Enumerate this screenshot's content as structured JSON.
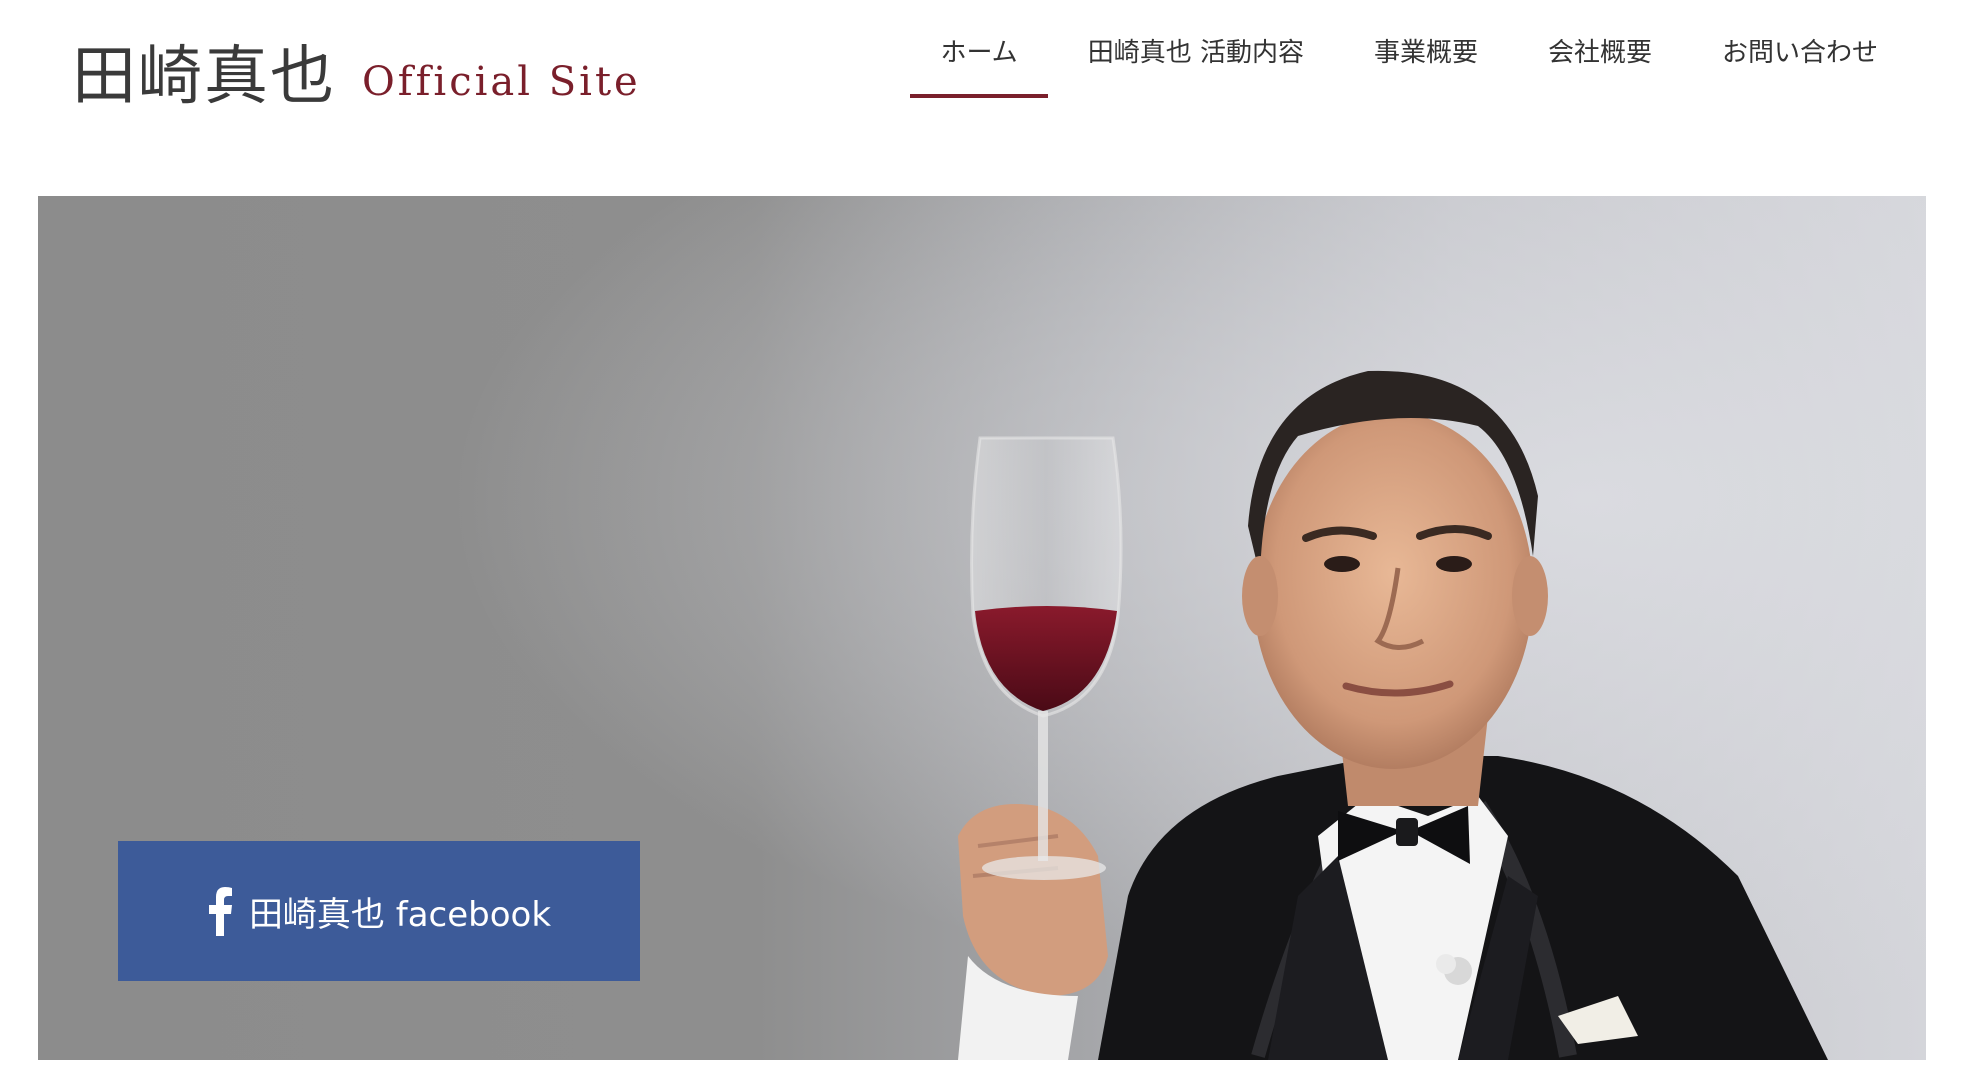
{
  "header": {
    "logo": {
      "name": "田崎真也",
      "subtitle": "Official Site"
    },
    "nav": {
      "items": [
        {
          "label": "ホーム",
          "active": true
        },
        {
          "label": "田崎真也 活動内容",
          "active": false
        },
        {
          "label": "事業概要",
          "active": false
        },
        {
          "label": "会社概要",
          "active": false
        },
        {
          "label": "お問い合わせ",
          "active": false
        }
      ]
    }
  },
  "hero": {
    "image": "portrait-sommelier-holding-red-wine-glass",
    "facebook_button": {
      "icon": "facebook-icon",
      "label": "田崎真也 facebook"
    }
  },
  "colors": {
    "accent": "#7a1f2b",
    "facebook": "#3d5b99",
    "nav_text": "#333333",
    "logo_text": "#3a3a3a"
  }
}
